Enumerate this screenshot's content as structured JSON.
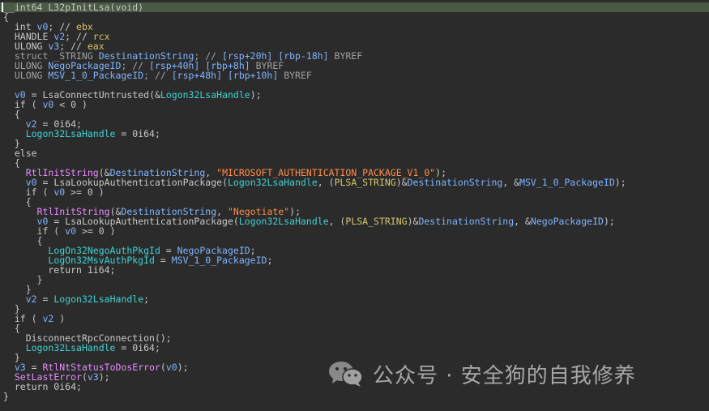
{
  "editor": {
    "lines": [
      "__int64 L32pInitLsa(void)",
      "{",
      "  int v0; // ebx",
      "  HANDLE v2; // rcx",
      "  ULONG v3; // eax",
      "  struct _STRING DestinationString; // [rsp+20h] [rbp-18h] BYREF",
      "  ULONG NegoPackageID; // [rsp+40h] [rbp+8h] BYREF",
      "  ULONG MSV_1_0_PackageID; // [rsp+48h] [rbp+10h] BYREF",
      "",
      "  v0 = LsaConnectUntrusted(&Logon32LsaHandle);",
      "  if ( v0 < 0 )",
      "  {",
      "    v2 = 0i64;",
      "    Logon32LsaHandle = 0i64;",
      "  }",
      "  else",
      "  {",
      "    RtlInitString(&DestinationString, \"MICROSOFT_AUTHENTICATION_PACKAGE_V1_0\");",
      "    v0 = LsaLookupAuthenticationPackage(Logon32LsaHandle, (PLSA_STRING)&DestinationString, &MSV_1_0_PackageID);",
      "    if ( v0 >= 0 )",
      "    {",
      "      RtlInitString(&DestinationString, \"Negotiate\");",
      "      v0 = LsaLookupAuthenticationPackage(Logon32LsaHandle, (PLSA_STRING)&DestinationString, &NegoPackageID);",
      "      if ( v0 >= 0 )",
      "      {",
      "        LogOn32NegoAuthPkgId = NegoPackageID;",
      "        LogOn32MsvAuthPkgId = MSV_1_0_PackageID;",
      "        return 1i64;",
      "      }",
      "    }",
      "    v2 = Logon32LsaHandle;",
      "  }",
      "  if ( v2 )",
      "  {",
      "    DisconnectRpcConnection();",
      "    Logon32LsaHandle = 0i64;",
      "  }",
      "  v3 = RtlNtStatusToDosError(v0);",
      "  SetLastError(v3);",
      "  return 0i64;",
      "}"
    ]
  },
  "watermark": {
    "text": "公众号 · 安全狗的自我修养",
    "icon": "wechat-icon"
  },
  "colors": {
    "background": "#2b2b2b",
    "highlight_line": "#4a5a44",
    "text": "#c8c8c8",
    "variable": "#7fb4ff",
    "string": "#ff8c4a",
    "import_function": "#e68cff",
    "global_data": "#3fd2d2",
    "register_comment": "#d6c56a"
  }
}
